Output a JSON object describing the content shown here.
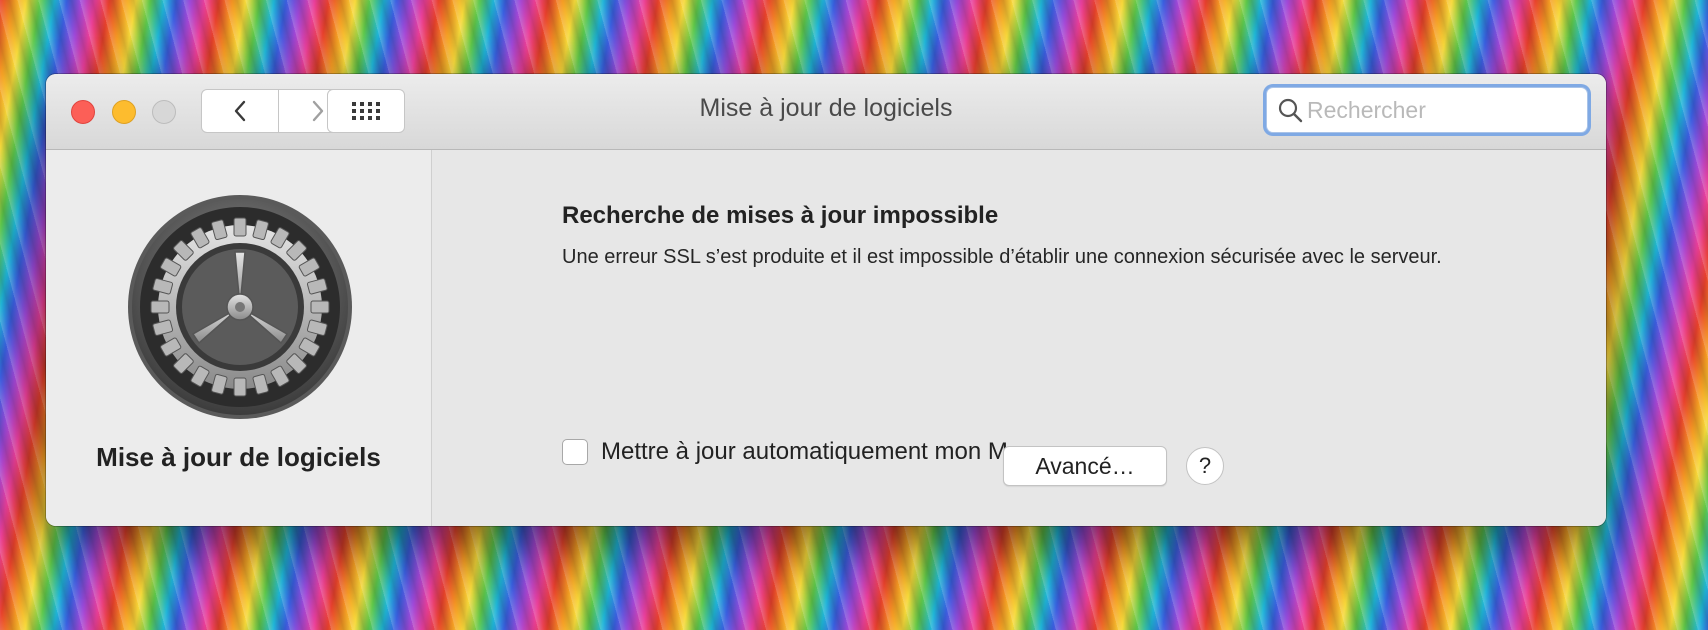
{
  "window": {
    "title": "Mise à jour de logiciels"
  },
  "toolbar": {
    "back_icon": "chevron-left-icon",
    "forward_icon": "chevron-right-icon",
    "grid_icon": "grid-icon",
    "search_placeholder": "Rechercher",
    "search_icon": "magnifier-icon"
  },
  "sidebar": {
    "icon": "gear-icon",
    "label": "Mise à jour de logiciels"
  },
  "content": {
    "heading": "Recherche de mises à jour impossible",
    "message": "Une erreur SSL s’est produite et il est impossible d’établir une connexion sécurisée avec le serveur.",
    "auto_update_label": "Mettre à jour automatiquement mon Mac",
    "auto_update_checked": false,
    "advanced_button": "Avancé…",
    "help_button": "?"
  },
  "colors": {
    "close": "#fc5f57",
    "minimize": "#fdbc2e",
    "zoom_disabled": "#d7d7d7",
    "search_focus": "#7fa9e4"
  }
}
